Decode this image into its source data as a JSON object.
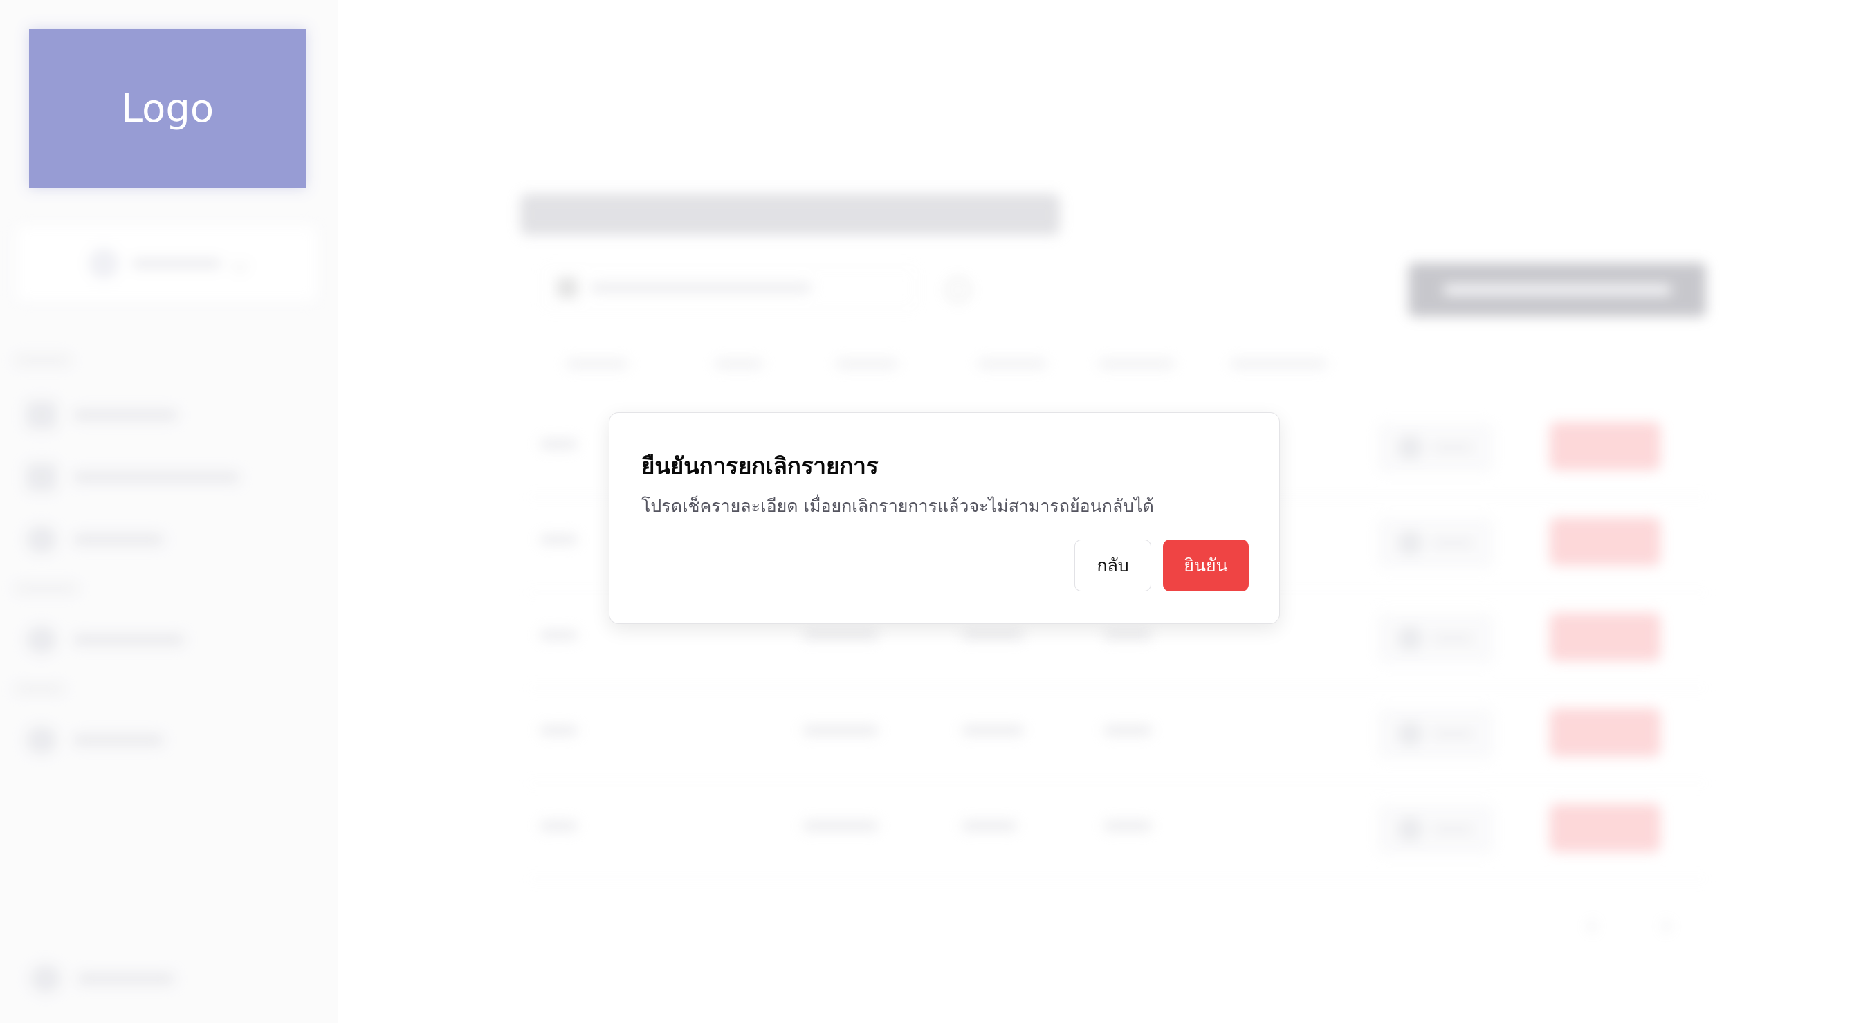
{
  "sidebar": {
    "logo_text": "Logo"
  },
  "dialog": {
    "title": "ยืนยันการยกเลิกรายการ",
    "description": "โปรดเช็ครายละเอียด เมื่อยกเลิกรายการแล้วจะไม่สามารถย้อนกลับได้",
    "back_label": "กลับ",
    "confirm_label": "ยินยัน"
  },
  "colors": {
    "brand": "#434bb1",
    "danger": "#ef4444"
  }
}
